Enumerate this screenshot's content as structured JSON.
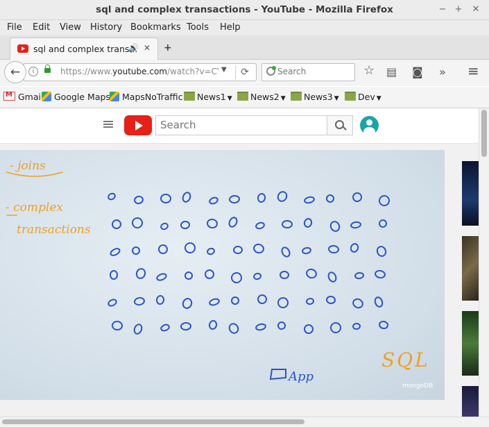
{
  "window": {
    "title": "sql and complex transactions - YouTube - Mozilla Firefox",
    "controls": {
      "minimize": "−",
      "maximize": "+",
      "close": "✕"
    }
  },
  "menu": [
    "File",
    "Edit",
    "View",
    "History",
    "Bookmarks",
    "Tools",
    "Help"
  ],
  "tab": {
    "label": "sql and complex trans...",
    "speaker": "🔊",
    "close": "✕",
    "new_tab": "+"
  },
  "nav": {
    "back": "←",
    "url_prefix": "https://www.",
    "url_domain": "youtube.com",
    "url_rest": "/watch?v=CYdjI",
    "reload": "⟳",
    "search_placeholder": "Search",
    "overflow": "»",
    "menu": "≡"
  },
  "bookmarks": [
    {
      "label": "Gmail",
      "icon": "gmail-icon"
    },
    {
      "label": "Google Maps",
      "icon": "maps-icon"
    },
    {
      "label": "MapsNoTraffic",
      "icon": "maps-icon"
    },
    {
      "label": "News1",
      "icon": "folder-icon"
    },
    {
      "label": "News2",
      "icon": "folder-icon"
    },
    {
      "label": "News3",
      "icon": "folder-icon"
    },
    {
      "label": "Dev",
      "icon": "folder-icon"
    }
  ],
  "youtube": {
    "search_placeholder": "Search"
  },
  "video": {
    "notes": [
      "- joins",
      "- complex",
      "transactions"
    ],
    "app_label": "App",
    "sql_label": "SQL",
    "watermark": "mongoDB",
    "note_color": "#f0a020",
    "ink_color": "#2a55c8"
  },
  "colors": {
    "youtube_red": "#e62117",
    "sql_orange": "#f0a020"
  }
}
